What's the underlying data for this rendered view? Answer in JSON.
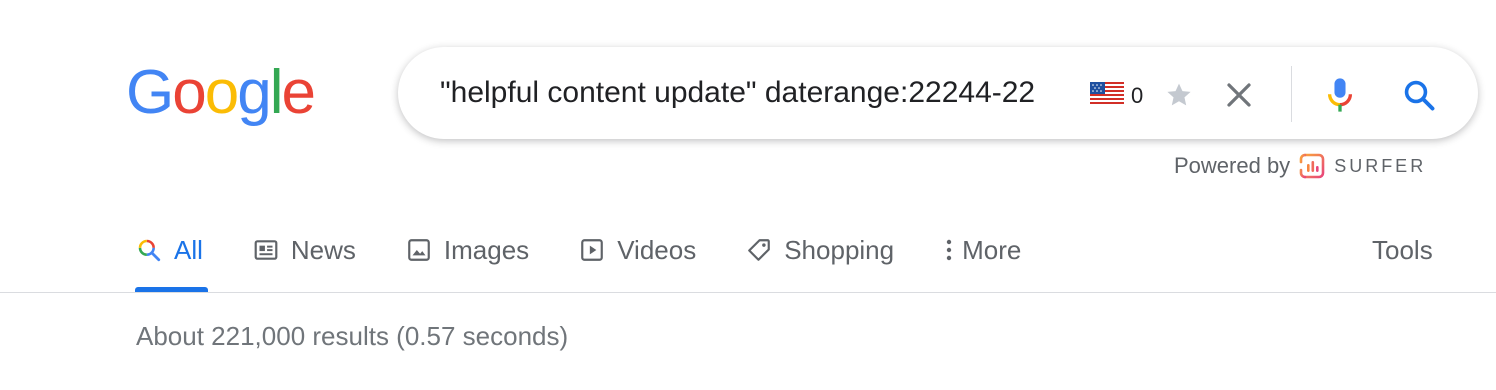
{
  "logo": {
    "letters": [
      "G",
      "o",
      "o",
      "g",
      "l",
      "e"
    ],
    "colors": [
      "#4285F4",
      "#EA4335",
      "#FBBC05",
      "#4285F4",
      "#34A853",
      "#EA4335"
    ]
  },
  "search": {
    "query": "\"helpful content update\" daterange:22244-22",
    "flag_icon": "us-flag-icon",
    "flag_count": "0"
  },
  "powered_by": {
    "label": "Powered by",
    "brand": "SURFER"
  },
  "tabs": [
    {
      "label": "All",
      "icon": "search-icon",
      "active": true
    },
    {
      "label": "News",
      "icon": "newspaper-icon",
      "active": false
    },
    {
      "label": "Images",
      "icon": "image-icon",
      "active": false
    },
    {
      "label": "Videos",
      "icon": "play-icon",
      "active": false
    },
    {
      "label": "Shopping",
      "icon": "tag-icon",
      "active": false
    },
    {
      "label": "More",
      "icon": "more-vert-icon",
      "active": false
    }
  ],
  "tools_label": "Tools",
  "result_stats": "About 221,000 results (0.57 seconds)",
  "colors": {
    "accent": "#1a73e8",
    "muted_text": "#5f6368",
    "stats_text": "#70757a",
    "divider": "#dadce0"
  }
}
